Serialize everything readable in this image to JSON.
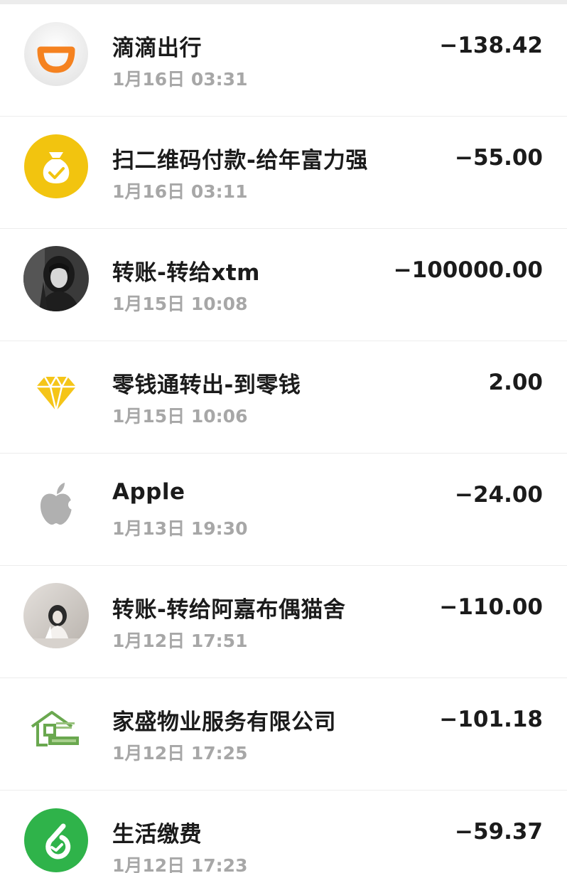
{
  "transactions": [
    {
      "icon": "didi-logo-icon",
      "title": "滴滴出行",
      "time": "1月16日 03:31",
      "amount": "−138.42"
    },
    {
      "icon": "money-bag-icon",
      "title": "扫二维码付款-给年富力强",
      "time": "1月16日 03:11",
      "amount": "−55.00"
    },
    {
      "icon": "user-avatar",
      "title": "转账-转给xtm",
      "time": "1月15日 10:08",
      "amount": "−100000.00"
    },
    {
      "icon": "diamond-icon",
      "title": "零钱通转出-到零钱",
      "time": "1月15日 10:06",
      "amount": "2.00"
    },
    {
      "icon": "apple-logo-icon",
      "title": "Apple",
      "time": "1月13日 19:30",
      "amount": "−24.00"
    },
    {
      "icon": "user-avatar",
      "title": "转账-转给阿嘉布偶猫舍",
      "time": "1月12日 17:51",
      "amount": "−110.00"
    },
    {
      "icon": "property-logo-icon",
      "title": "家盛物业服务有限公司",
      "time": "1月12日 17:25",
      "amount": "−101.18"
    },
    {
      "icon": "utility-pay-icon",
      "title": "生活缴费",
      "time": "1月12日 17:23",
      "amount": "−59.37"
    }
  ],
  "colors": {
    "didi_orange": "#f58220",
    "pay_yellow": "#f2c40f",
    "diamond_gold": "#f5c518",
    "apple_gray": "#b0b0b0",
    "property_green": "#6aa84f",
    "utility_green": "#2fb34a",
    "title_text": "#1b1b1b",
    "time_text": "#a7a7a7"
  }
}
